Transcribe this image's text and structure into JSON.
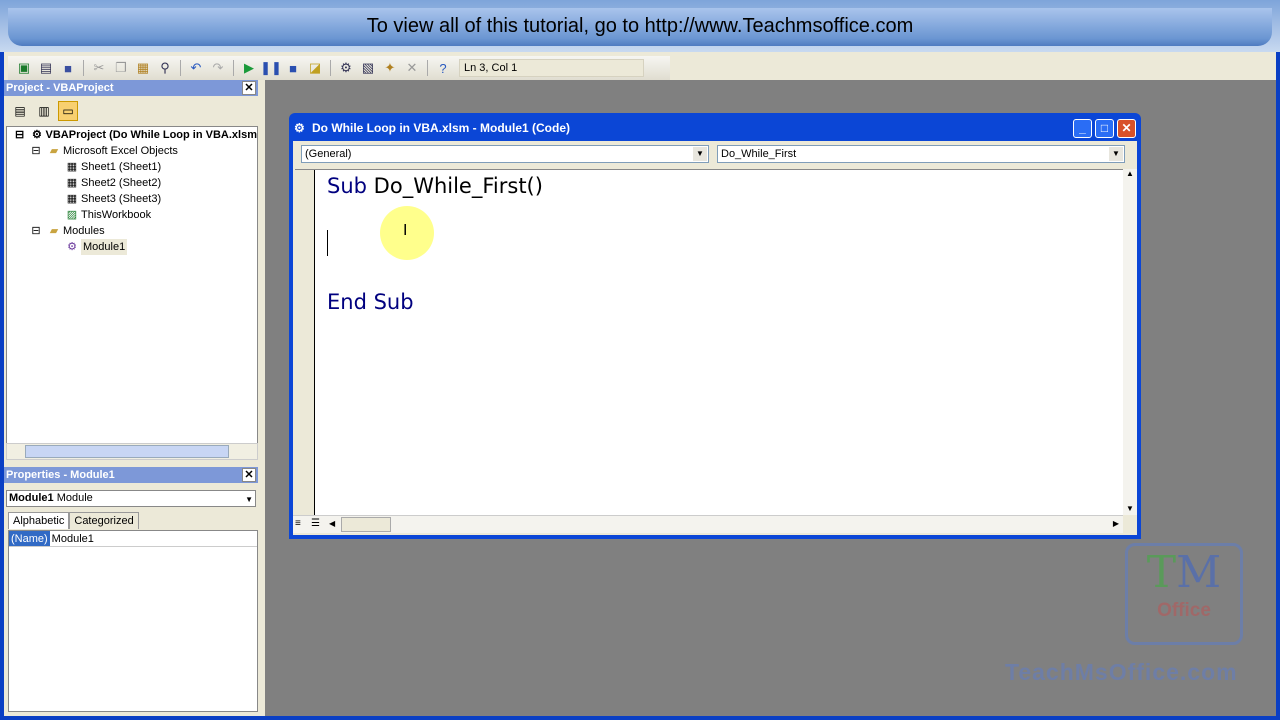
{
  "banner": {
    "text": "To view all of this tutorial, go to http://www.Teachmsoffice.com"
  },
  "toolbar": {
    "icons": [
      "excel-icon",
      "insert-userform-icon",
      "save-icon",
      "cut-icon",
      "copy-icon",
      "paste-icon",
      "find-icon",
      "undo-icon",
      "redo-icon",
      "run-icon",
      "break-icon",
      "reset-icon",
      "design-mode-icon",
      "project-explorer-icon",
      "properties-window-icon",
      "object-browser-icon",
      "toolbox-icon",
      "help-icon"
    ],
    "position": "Ln 3, Col 1"
  },
  "project": {
    "title": "Project - VBAProject",
    "tree": [
      {
        "label": "VBAProject (Do While Loop in VBA.xlsm",
        "level": 0
      },
      {
        "label": "Microsoft Excel Objects",
        "level": 1
      },
      {
        "label": "Sheet1 (Sheet1)",
        "level": 2
      },
      {
        "label": "Sheet2 (Sheet2)",
        "level": 2
      },
      {
        "label": "Sheet3 (Sheet3)",
        "level": 2
      },
      {
        "label": "ThisWorkbook",
        "level": 2
      },
      {
        "label": "Modules",
        "level": 1
      },
      {
        "label": "Module1",
        "level": 2
      }
    ]
  },
  "properties": {
    "title": "Properties - Module1",
    "object_name": "Module1",
    "object_type": "Module",
    "tabs": [
      "Alphabetic",
      "Categorized"
    ],
    "rows": [
      {
        "name": "(Name)",
        "value": "Module1"
      }
    ]
  },
  "code_window": {
    "title": "Do While Loop in VBA.xlsm - Module1 (Code)",
    "object_combo": "(General)",
    "proc_combo": "Do_While_First",
    "lines": {
      "l1_kw": "Sub",
      "l1_id": "Do_While_First()",
      "l3": "End Sub"
    }
  },
  "watermark": {
    "logo_tm": "TM",
    "logo_office": "Office",
    "site": "TeachMsOffice.com"
  },
  "colors": {
    "titlebar": "#0b46d6",
    "code_keyword": "#00007f",
    "pane_title": "#7d98d8"
  }
}
